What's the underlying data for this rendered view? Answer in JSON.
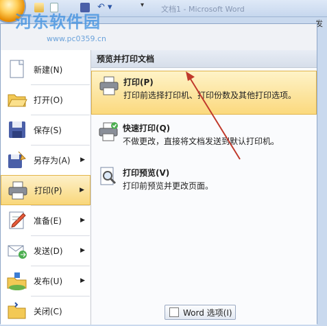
{
  "watermark": {
    "text": "河东软件园",
    "url": "www.pc0359.cn"
  },
  "titlebar": {
    "faint_text": "文档1 - Microsoft Word",
    "ribbon_tab_partial": "发"
  },
  "left_menu": {
    "items": [
      {
        "label": "新建(N)",
        "icon": "new-document-icon",
        "has_arrow": false
      },
      {
        "label": "打开(O)",
        "icon": "open-folder-icon",
        "has_arrow": false
      },
      {
        "label": "保存(S)",
        "icon": "save-disk-icon",
        "has_arrow": false
      },
      {
        "label": "另存为(A)",
        "icon": "save-as-icon",
        "has_arrow": true
      },
      {
        "label": "打印(P)",
        "icon": "printer-icon",
        "has_arrow": true,
        "active": true
      },
      {
        "label": "准备(E)",
        "icon": "prepare-pencil-icon",
        "has_arrow": true
      },
      {
        "label": "发送(D)",
        "icon": "send-mail-icon",
        "has_arrow": true
      },
      {
        "label": "发布(U)",
        "icon": "publish-icon",
        "has_arrow": true
      },
      {
        "label": "关闭(C)",
        "icon": "close-folder-icon",
        "has_arrow": false
      }
    ]
  },
  "right_panel": {
    "header": "预览并打印文档",
    "items": [
      {
        "title": "打印(P)",
        "desc": "打印前选择打印机、打印份数及其他打印选项。",
        "icon": "printer-icon",
        "highlighted": true
      },
      {
        "title": "快速打印(Q)",
        "desc": "不做更改，直接将文档发送到默认打印机。",
        "icon": "quick-print-icon",
        "highlighted": false
      },
      {
        "title": "打印预览(V)",
        "desc": "打印前预览并更改页面。",
        "icon": "print-preview-icon",
        "highlighted": false
      }
    ]
  },
  "bottom": {
    "word_options_label": "Word 选项(I)"
  },
  "colors": {
    "highlight": "#fbd97e",
    "annotation_arrow": "#c0392b",
    "menu_border": "#8ea6c7"
  }
}
